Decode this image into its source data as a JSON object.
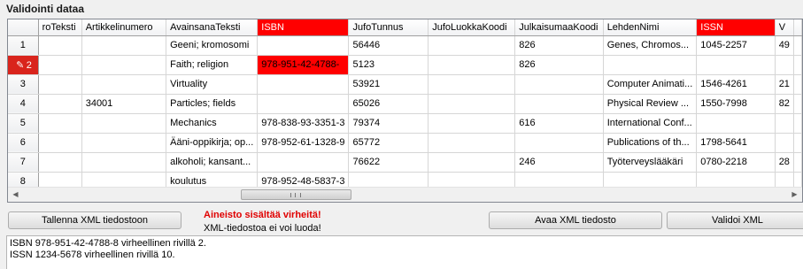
{
  "window": {
    "title": "Validointi dataa"
  },
  "grid": {
    "columns": [
      {
        "label": "roTeksti",
        "error": false
      },
      {
        "label": "Artikkelinumero",
        "error": false
      },
      {
        "label": "AvainsanaTeksti",
        "error": false
      },
      {
        "label": "ISBN",
        "error": true
      },
      {
        "label": "JufoTunnus",
        "error": false
      },
      {
        "label": "JufoLuokkaKoodi",
        "error": false
      },
      {
        "label": "JulkaisumaaKoodi",
        "error": false
      },
      {
        "label": "LehdenNimi",
        "error": false
      },
      {
        "label": "ISSN",
        "error": true
      },
      {
        "label": "V",
        "error": false
      }
    ],
    "rows": [
      {
        "num": "1",
        "cells": [
          "",
          "",
          "Geeni; kromosomi",
          "",
          "56446",
          "",
          "826",
          "Genes, Chromos...",
          "1045-2257",
          "49"
        ]
      },
      {
        "num": "2",
        "cells": [
          "",
          "",
          "Faith; religion",
          "978-951-42-4788-",
          "5123",
          "",
          "826",
          "",
          "",
          ""
        ]
      },
      {
        "num": "3",
        "cells": [
          "",
          "",
          "Virtuality",
          "",
          "53921",
          "",
          "",
          "Computer Animati...",
          "1546-4261",
          "21"
        ]
      },
      {
        "num": "4",
        "cells": [
          "",
          "34001",
          "Particles; fields",
          "",
          "65026",
          "",
          "",
          "Physical Review ...",
          "1550-7998",
          "82"
        ]
      },
      {
        "num": "5",
        "cells": [
          "",
          "",
          "Mechanics",
          "978-838-93-3351-3",
          "79374",
          "",
          "616",
          "International Conf...",
          "",
          ""
        ]
      },
      {
        "num": "6",
        "cells": [
          "",
          "",
          "Ääni-oppikirja; op...",
          "978-952-61-1328-9",
          "65772",
          "",
          "",
          "Publications of th...",
          "1798-5641",
          ""
        ]
      },
      {
        "num": "7",
        "cells": [
          "",
          "",
          "alkoholi; kansant...",
          "",
          "76622",
          "",
          "246",
          "Työterveyslääkäri",
          "0780-2218",
          "28"
        ]
      },
      {
        "num": "8",
        "cells": [
          "",
          "",
          "koulutus",
          "978-952-48-5837-3",
          "",
          "",
          "",
          "",
          "",
          ""
        ]
      }
    ],
    "selected_row": 1,
    "error_cell": {
      "row": 1,
      "col": 3
    },
    "edit_icon": "pencil-icon"
  },
  "buttons": {
    "save": "Tallenna XML tiedostoon",
    "open": "Avaa XML tiedosto",
    "validate": "Validoi XML"
  },
  "status": {
    "error_title": "Aineisto sisältää virheitä!",
    "error_message": "XML-tiedostoa ei voi luoda!"
  },
  "log": [
    "ISBN 978-951-42-4788-8 virheellinen rivillä 2.",
    "ISSN 1234-5678 virheellinen rivillä 10."
  ],
  "colors": {
    "error": "#ff0000",
    "error_text": "#e00000",
    "selected_row_header": "#d9241c"
  }
}
